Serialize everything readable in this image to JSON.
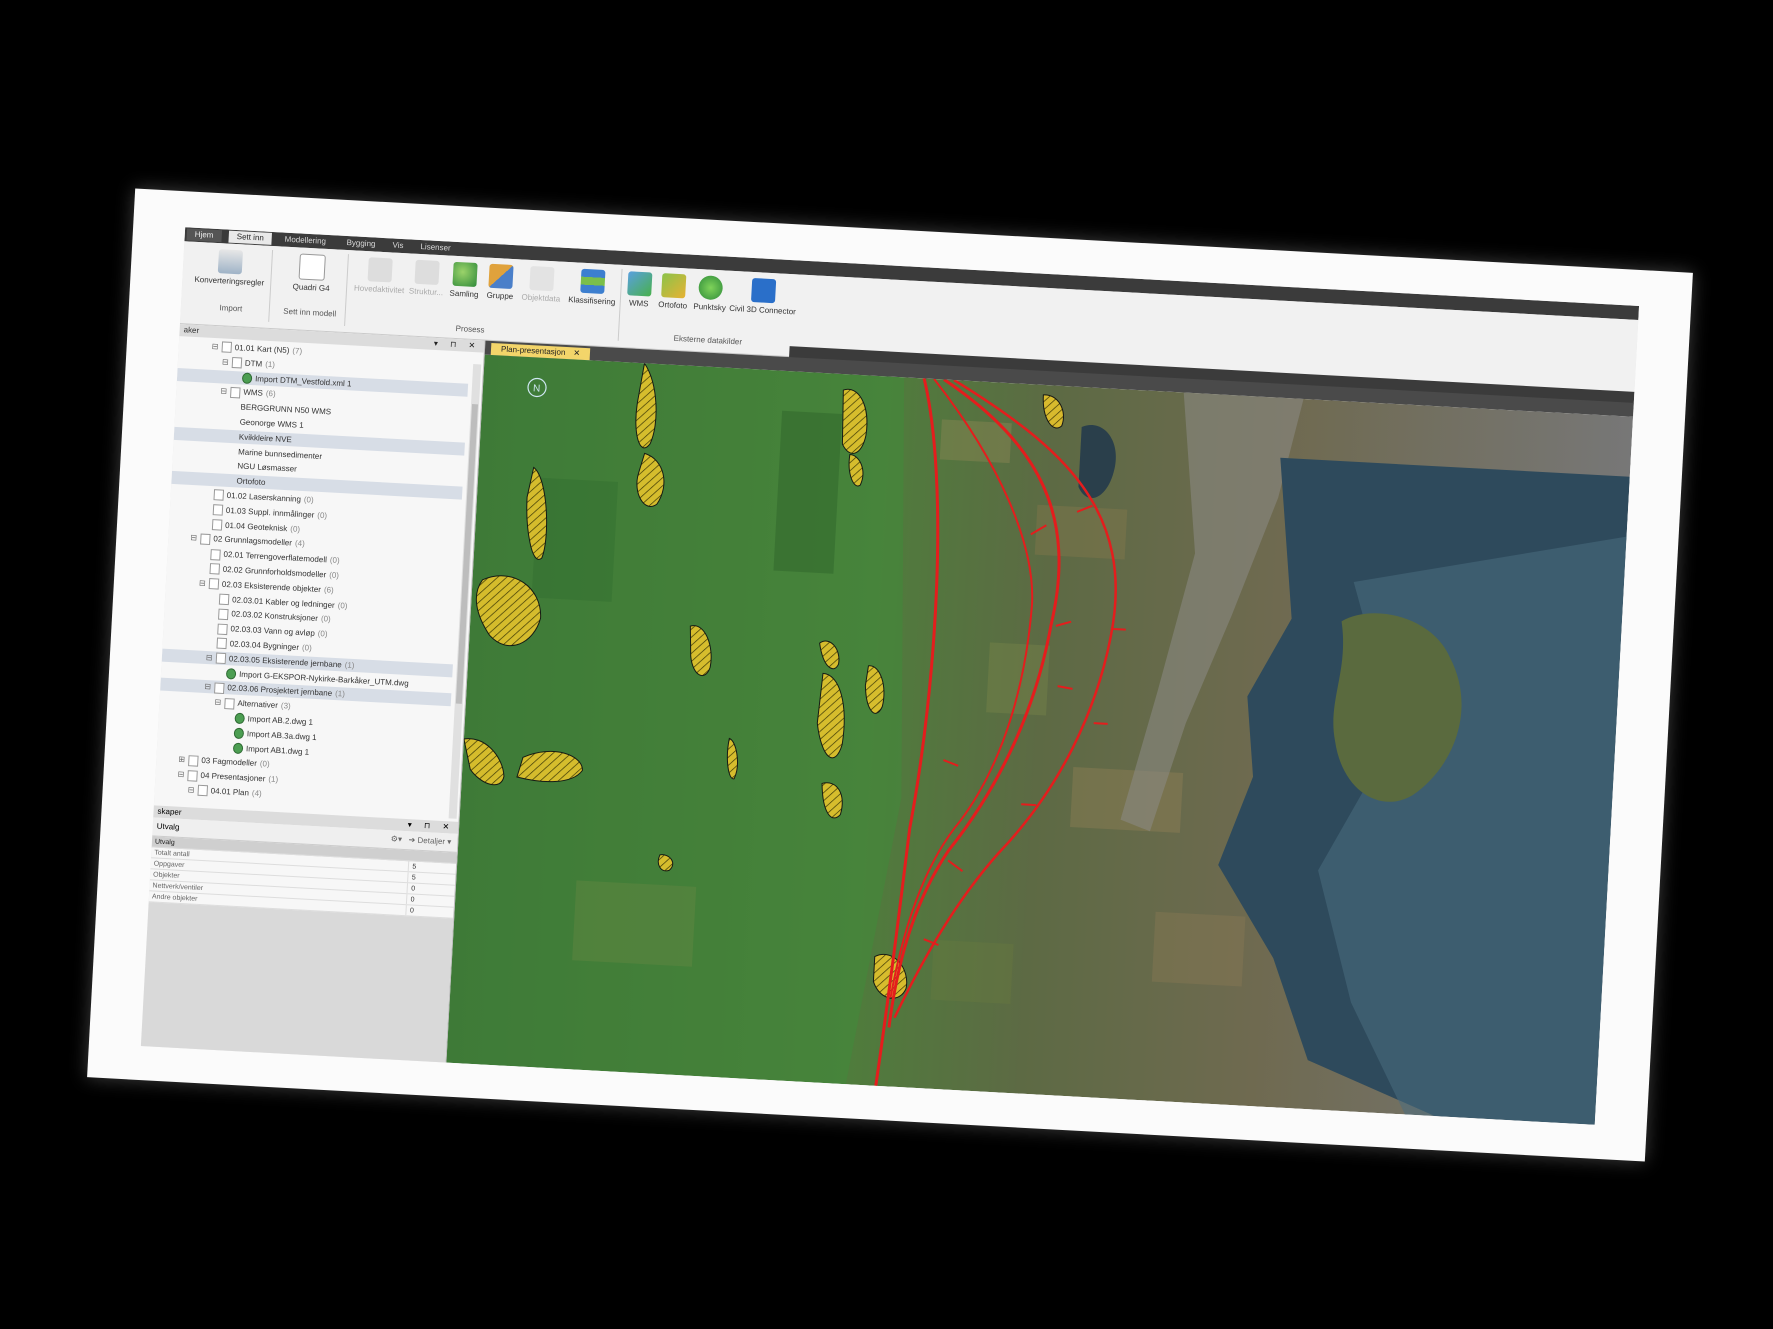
{
  "ribbon": {
    "tabs": [
      "Hjem",
      "Sett inn",
      "Modellering",
      "Bygging",
      "Vis",
      "Lisenser"
    ],
    "active_tab": "Sett inn",
    "buttons": [
      {
        "label": "Konverteringsregler",
        "icon": "rules-icon"
      },
      {
        "label": "Quadri G4",
        "icon": "document-icon"
      },
      {
        "label": "Hovedaktivitet",
        "icon": "activity-icon",
        "disabled": true
      },
      {
        "label": "Struktur...",
        "icon": "structure-icon",
        "disabled": true
      },
      {
        "label": "Samling",
        "icon": "collection-icon"
      },
      {
        "label": "Gruppe",
        "icon": "group-icon"
      },
      {
        "label": "Objektdata",
        "icon": "objectdata-icon",
        "disabled": true
      },
      {
        "label": "Klassifisering",
        "icon": "classification-icon"
      },
      {
        "label": "WMS",
        "icon": "wms-icon"
      },
      {
        "label": "Ortofoto",
        "icon": "orthophoto-icon"
      },
      {
        "label": "Punktsky",
        "icon": "pointcloud-icon"
      },
      {
        "label": "Civil 3D Connector",
        "icon": "civil3d-icon"
      }
    ],
    "groups": [
      "Import",
      "Sett inn modell",
      "Prosess",
      "Eksterne datakilder"
    ]
  },
  "project_panel": {
    "title": "aker",
    "controls": "▾ ⊓ ✕",
    "rows": [
      {
        "label": "01.01 Kart (N5)",
        "count": "(7)",
        "indent": 3,
        "toggle": "⊟",
        "icon": "folder"
      },
      {
        "label": "DTM",
        "count": "(1)",
        "indent": 4,
        "toggle": "⊟",
        "icon": "folder"
      },
      {
        "label": "Import DTM_Vestfold.xml 1",
        "count": "",
        "indent": 5,
        "toggle": "",
        "icon": "import",
        "selected": true
      },
      {
        "label": "WMS",
        "count": "(6)",
        "indent": 4,
        "toggle": "⊟",
        "icon": "folder"
      },
      {
        "label": "BERGGRUNN N50 WMS",
        "count": "",
        "indent": 5,
        "toggle": "",
        "icon": "map"
      },
      {
        "label": "Geonorge WMS 1",
        "count": "",
        "indent": 5,
        "toggle": "",
        "icon": "map"
      },
      {
        "label": "Kvikkleire NVE",
        "count": "",
        "indent": 5,
        "toggle": "",
        "icon": "map",
        "selected": true
      },
      {
        "label": "Marine bunnsedimenter",
        "count": "",
        "indent": 5,
        "toggle": "",
        "icon": "map"
      },
      {
        "label": "NGU Løsmasser",
        "count": "",
        "indent": 5,
        "toggle": "",
        "icon": "map"
      },
      {
        "label": "Ortofoto",
        "count": "",
        "indent": 5,
        "toggle": "",
        "icon": "map",
        "selected": true
      },
      {
        "label": "01.02 Laserskanning",
        "count": "(0)",
        "indent": 3,
        "toggle": "",
        "icon": "folder"
      },
      {
        "label": "01.03 Suppl. innmålinger",
        "count": "(0)",
        "indent": 3,
        "toggle": "",
        "icon": "folder"
      },
      {
        "label": "01.04 Geoteknisk",
        "count": "(0)",
        "indent": 3,
        "toggle": "",
        "icon": "folder"
      },
      {
        "label": "02 Grunnlagsmodeller",
        "count": "(4)",
        "indent": 2,
        "toggle": "⊟",
        "icon": "folder"
      },
      {
        "label": "02.01 Terrengoverflatemodell",
        "count": "(0)",
        "indent": 3,
        "toggle": "",
        "icon": "folder"
      },
      {
        "label": "02.02 Grunnforholdsmodeller",
        "count": "(0)",
        "indent": 3,
        "toggle": "",
        "icon": "folder"
      },
      {
        "label": "02.03 Eksisterende objekter",
        "count": "(6)",
        "indent": 3,
        "toggle": "⊟",
        "icon": "folder"
      },
      {
        "label": "02.03.01 Kabler og ledninger",
        "count": "(0)",
        "indent": 4,
        "toggle": "",
        "icon": "folder"
      },
      {
        "label": "02.03.02 Konstruksjoner",
        "count": "(0)",
        "indent": 4,
        "toggle": "",
        "icon": "folder"
      },
      {
        "label": "02.03.03 Vann og avløp",
        "count": "(0)",
        "indent": 4,
        "toggle": "",
        "icon": "folder"
      },
      {
        "label": "02.03.04 Bygninger",
        "count": "(0)",
        "indent": 4,
        "toggle": "",
        "icon": "folder"
      },
      {
        "label": "02.03.05 Eksisterende jernbane",
        "count": "(1)",
        "indent": 4,
        "toggle": "⊟",
        "icon": "folder",
        "selected": true
      },
      {
        "label": "Import G-EKSPOR-Nykirke-Barkåker_UTM.dwg",
        "count": "",
        "indent": 5,
        "toggle": "",
        "icon": "import"
      },
      {
        "label": "02.03.06 Prosjektert jernbane",
        "count": "(1)",
        "indent": 4,
        "toggle": "⊟",
        "icon": "folder",
        "selected": true
      },
      {
        "label": "Alternativer",
        "count": "(3)",
        "indent": 5,
        "toggle": "⊟",
        "icon": "folder"
      },
      {
        "label": "Import AB.2.dwg 1",
        "count": "",
        "indent": 6,
        "toggle": "",
        "icon": "import"
      },
      {
        "label": "Import AB.3a.dwg 1",
        "count": "",
        "indent": 6,
        "toggle": "",
        "icon": "import"
      },
      {
        "label": "Import AB1.dwg 1",
        "count": "",
        "indent": 6,
        "toggle": "",
        "icon": "import"
      },
      {
        "label": "03 Fagmodeller",
        "count": "(0)",
        "indent": 2,
        "toggle": "⊞",
        "icon": "folder"
      },
      {
        "label": "04 Presentasjoner",
        "count": "(1)",
        "indent": 2,
        "toggle": "⊟",
        "icon": "folder"
      },
      {
        "label": "04.01 Plan",
        "count": "(4)",
        "indent": 3,
        "toggle": "⊟",
        "icon": "folder"
      }
    ]
  },
  "properties_panel": {
    "title": "skaper",
    "controls": "▾ ⊓ ✕",
    "filter_value": "Utvalg",
    "details_label": "Detaljer",
    "group_label": "Utvalg",
    "rows": [
      {
        "label": "Totalt antall",
        "value": "5"
      },
      {
        "label": "Oppgaver",
        "value": "5"
      },
      {
        "label": "Objekter",
        "value": "0"
      },
      {
        "label": "Nettverk/ventiler",
        "value": "0"
      },
      {
        "label": "Andre objekter",
        "value": "0"
      }
    ]
  },
  "document": {
    "tab_label": "Plan-presentasjon",
    "close_glyph": "✕",
    "north_label": "N"
  }
}
